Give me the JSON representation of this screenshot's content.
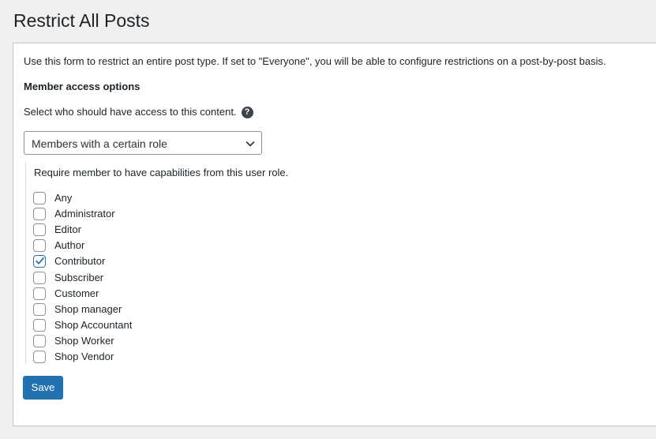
{
  "page": {
    "title": "Restrict All Posts"
  },
  "form": {
    "intro": "Use this form to restrict an entire post type. If set to \"Everyone\", you will be able to configure restrictions on a post-by-post basis.",
    "section_heading": "Member access options",
    "access_prompt": "Select who should have access to this content.",
    "help_icon": "question-circle-icon",
    "help_glyph": "?",
    "access_select": {
      "selected": "Members with a certain role"
    },
    "role_note": "Require member to have capabilities from this user role.",
    "roles": [
      {
        "label": "Any",
        "checked": false
      },
      {
        "label": "Administrator",
        "checked": false
      },
      {
        "label": "Editor",
        "checked": false
      },
      {
        "label": "Author",
        "checked": false
      },
      {
        "label": "Contributor",
        "checked": true
      },
      {
        "label": "Subscriber",
        "checked": false
      },
      {
        "label": "Customer",
        "checked": false
      },
      {
        "label": "Shop manager",
        "checked": false
      },
      {
        "label": "Shop Accountant",
        "checked": false
      },
      {
        "label": "Shop Worker",
        "checked": false
      },
      {
        "label": "Shop Vendor",
        "checked": false
      }
    ],
    "save_label": "Save"
  },
  "colors": {
    "accent": "#2271b1",
    "page_background": "#f0f0f1",
    "panel_border": "#c3c4c7",
    "text": "#1d2327"
  }
}
